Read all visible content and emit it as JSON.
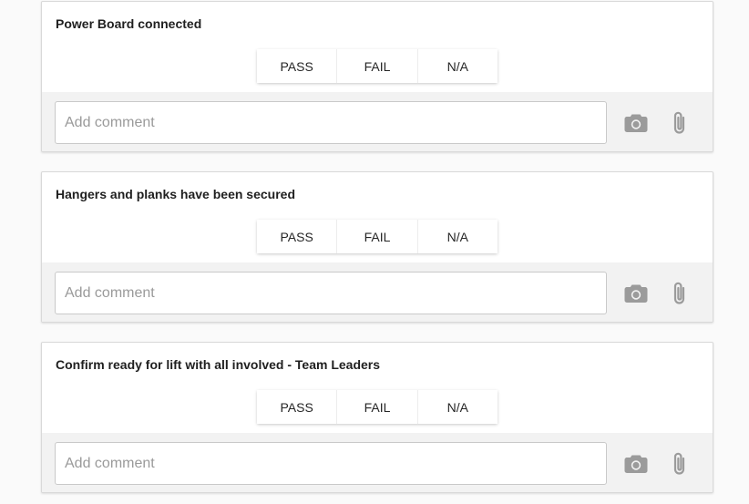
{
  "checklist": {
    "items": [
      {
        "title": "Power Board connected",
        "options": [
          "PASS",
          "FAIL",
          "N/A"
        ],
        "comment_placeholder": "Add comment",
        "comment_value": ""
      },
      {
        "title": "Hangers and planks have been secured",
        "options": [
          "PASS",
          "FAIL",
          "N/A"
        ],
        "comment_placeholder": "Add comment",
        "comment_value": ""
      },
      {
        "title": "Confirm ready for lift with all involved - Team Leaders",
        "options": [
          "PASS",
          "FAIL",
          "N/A"
        ],
        "comment_placeholder": "Add comment",
        "comment_value": ""
      }
    ],
    "icons": {
      "photo": "camera-icon",
      "attach": "paperclip-icon"
    },
    "colors": {
      "icon": "#9b9b9b",
      "card_bg": "#ffffff",
      "comment_bar_bg": "#f2f2f2",
      "page_bg": "#fafafa"
    }
  }
}
